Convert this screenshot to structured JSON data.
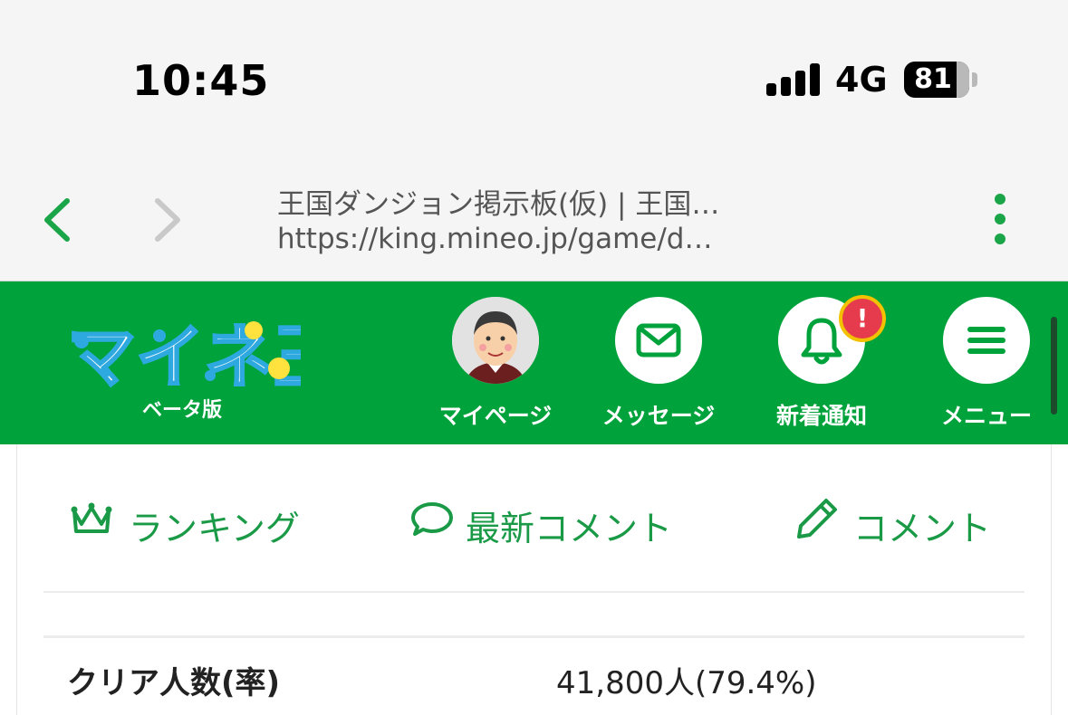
{
  "status_bar": {
    "time": "10:45",
    "network": "4G",
    "battery_level": "81"
  },
  "browser": {
    "page_title": "王国ダンジョン掲示板(仮) | 王国…",
    "url": "https://king.mineo.jp/game/d…"
  },
  "header": {
    "logo_text": "マイネ王",
    "beta_label": "ベータ版",
    "nav": [
      {
        "label": "マイページ",
        "icon": "avatar-icon"
      },
      {
        "label": "メッセージ",
        "icon": "envelope-icon"
      },
      {
        "label": "新着通知",
        "icon": "bell-icon"
      },
      {
        "label": "メニュー",
        "icon": "hamburger-icon"
      }
    ],
    "notification_badge": "!"
  },
  "tabs": [
    {
      "label": "ランキング",
      "icon": "crown-icon"
    },
    {
      "label": "最新コメント",
      "icon": "speech-bubble-icon"
    },
    {
      "label": "コメント",
      "icon": "pencil-icon"
    }
  ],
  "stats": [
    {
      "label": "クリア人数(率)",
      "value": "41,800人(79.4%)"
    }
  ],
  "colors": {
    "brand_green": "#00a23b",
    "accent_green": "#1a9a46",
    "badge_red": "#e63b4d"
  }
}
